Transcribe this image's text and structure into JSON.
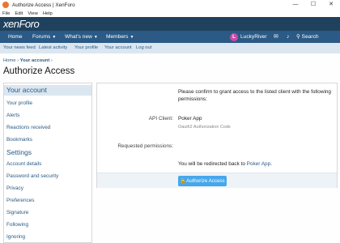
{
  "window": {
    "title": "Authorize Access | XenForo",
    "minimize": "—",
    "maximize": "☐",
    "close": "✕"
  },
  "menubar": [
    "File",
    "Edit",
    "View",
    "Help"
  ],
  "header": {
    "logo": "xenForo"
  },
  "nav": {
    "home": "Home",
    "forums": "Forums",
    "whats_new": "What's new",
    "members": "Members",
    "avatar_letter": "L",
    "username": "LuckyRiver",
    "search": "Search"
  },
  "subnav": [
    "Your news feed",
    "Latest activity",
    "Your profile",
    "Your account",
    "Log out"
  ],
  "breadcrumb": {
    "home": "Home",
    "sep": "›",
    "current": "Your account",
    "sep2": "›"
  },
  "page_title": "Authorize Access",
  "sidebar": {
    "heading1": "Your account",
    "items1": [
      "Your profile",
      "Alerts",
      "Reactions received",
      "Bookmarks"
    ],
    "heading2": "Settings",
    "items2": [
      "Account details",
      "Password and security",
      "Privacy",
      "Preferences",
      "Signature",
      "Following",
      "Ignoring"
    ]
  },
  "main": {
    "intro": "Please confirm to grant access to the listed client with the following permissions:",
    "api_client_label": "API Client:",
    "api_client_value": "Poker App",
    "api_client_sub": "Oauth2 Authorization Code",
    "permissions_label": "Requested permissions:",
    "redirect_prefix": "You will be redirected back to ",
    "redirect_link": "Poker App",
    "redirect_suffix": ".",
    "button": "Authorize Access"
  },
  "colors": {
    "header": "#20415e",
    "nav": "#2a5a85",
    "subnav": "#dbe6f0",
    "button": "#47a7eb"
  }
}
